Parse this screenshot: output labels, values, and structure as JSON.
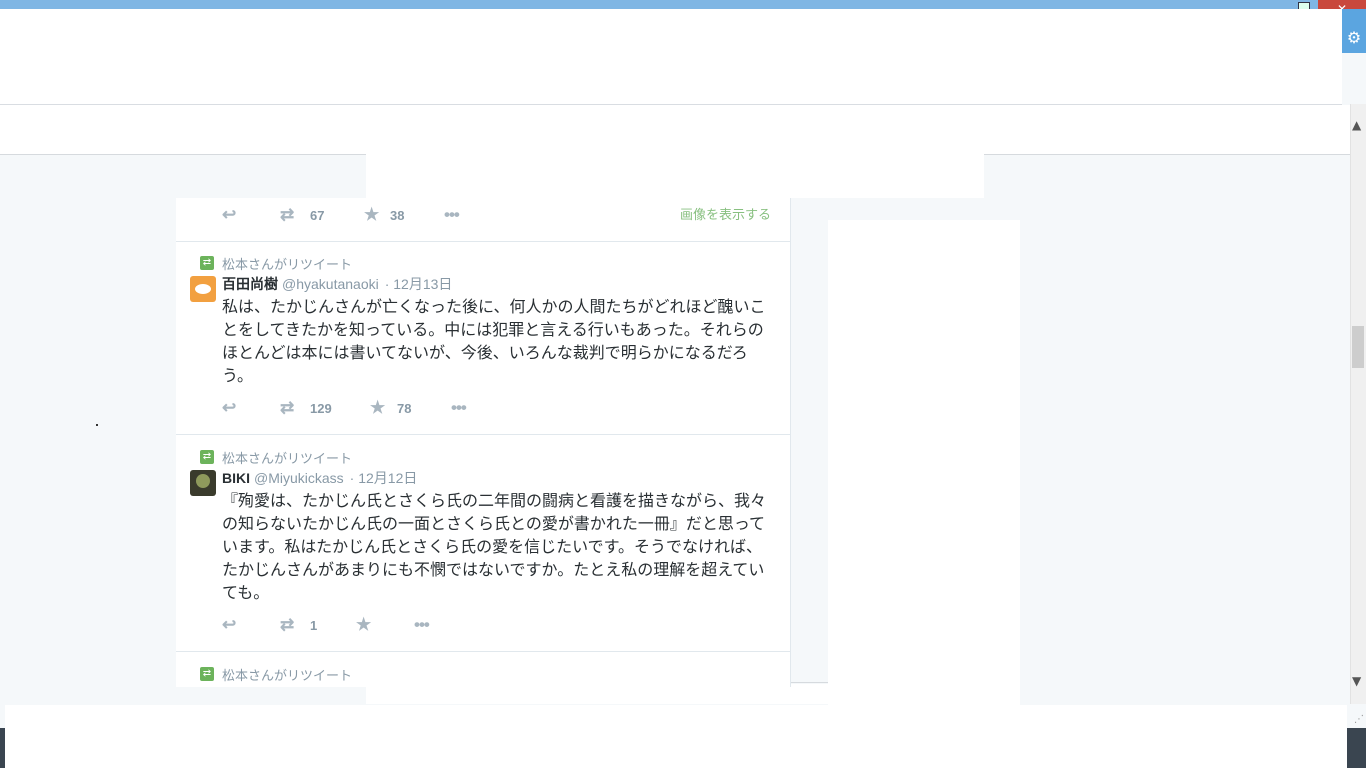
{
  "window": {
    "close_glyph": "✕",
    "settings_icon": "gear-icon"
  },
  "top_tweet": {
    "show_image_label": "画像を表示する",
    "retweets": "67",
    "likes": "38"
  },
  "tweets": [
    {
      "retweeted_by": "松本さんがリツイート",
      "name": "百田尚樹",
      "handle": "@hyakutanaoki",
      "time": "· 12月13日",
      "text": "私は、たかじんさんが亡くなった後に、何人かの人間たちがどれほど醜いことをしてきたかを知っている。中には犯罪と言える行いもあった。それらのほとんどは本には書いてないが、今後、いろんな裁判で明らかになるだろう。",
      "retweets": "129",
      "likes": "78"
    },
    {
      "retweeted_by": "松本さんがリツイート",
      "name": "BIKI",
      "handle": "@Miyukickass",
      "time": "· 12月12日",
      "text": "『殉愛は、たかじん氏とさくら氏の二年間の闘病と看護を描きながら、我々の知らないたかじん氏の一面とさくら氏との愛が書かれた一冊』だと思っています。私はたかじん氏とさくら氏の愛を信じたいです。そうでなければ、たかじんさんがあまりにも不憫ではないですか。たとえ私の理解を超えていても。",
      "retweets": "1",
      "likes": ""
    },
    {
      "retweeted_by": "松本さんがリツイート"
    }
  ]
}
